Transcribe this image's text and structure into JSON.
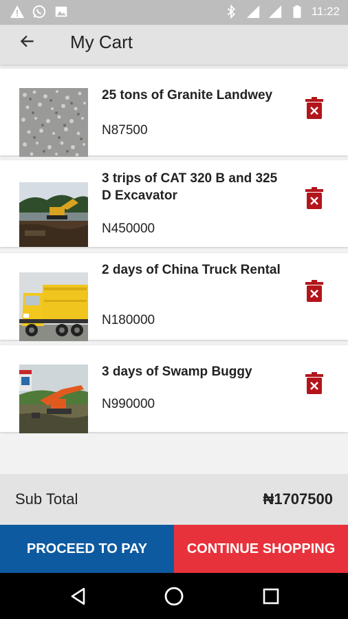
{
  "status_bar": {
    "time": "11:22",
    "network_1": "LTE",
    "network_2": "2G",
    "icons": [
      "warning-icon",
      "whatsapp-icon",
      "image-icon",
      "bluetooth-icon",
      "signal-icon",
      "battery-icon"
    ]
  },
  "header": {
    "title": "My Cart",
    "back_icon": "arrow-left-icon"
  },
  "cart": {
    "items": [
      {
        "name": "25 tons of Granite Landwey",
        "price": "N87500",
        "image": "granite"
      },
      {
        "name": "3 trips of CAT 320 B and 325 D Excavator",
        "price": "N450000",
        "image": "excavator"
      },
      {
        "name": "2 days of China Truck Rental",
        "price": "N180000",
        "image": "truck"
      },
      {
        "name": "3 days of Swamp Buggy",
        "price": "N990000",
        "image": "swamp-buggy"
      }
    ]
  },
  "summary": {
    "subtotal_label": "Sub Total",
    "subtotal_value": "₦1707500"
  },
  "actions": {
    "proceed_label": "PROCEED TO PAY",
    "continue_label": "CONTINUE SHOPPING"
  },
  "colors": {
    "primary_blue": "#0e5aa0",
    "accent_red": "#e8323b",
    "delete_red": "#b3151b"
  }
}
